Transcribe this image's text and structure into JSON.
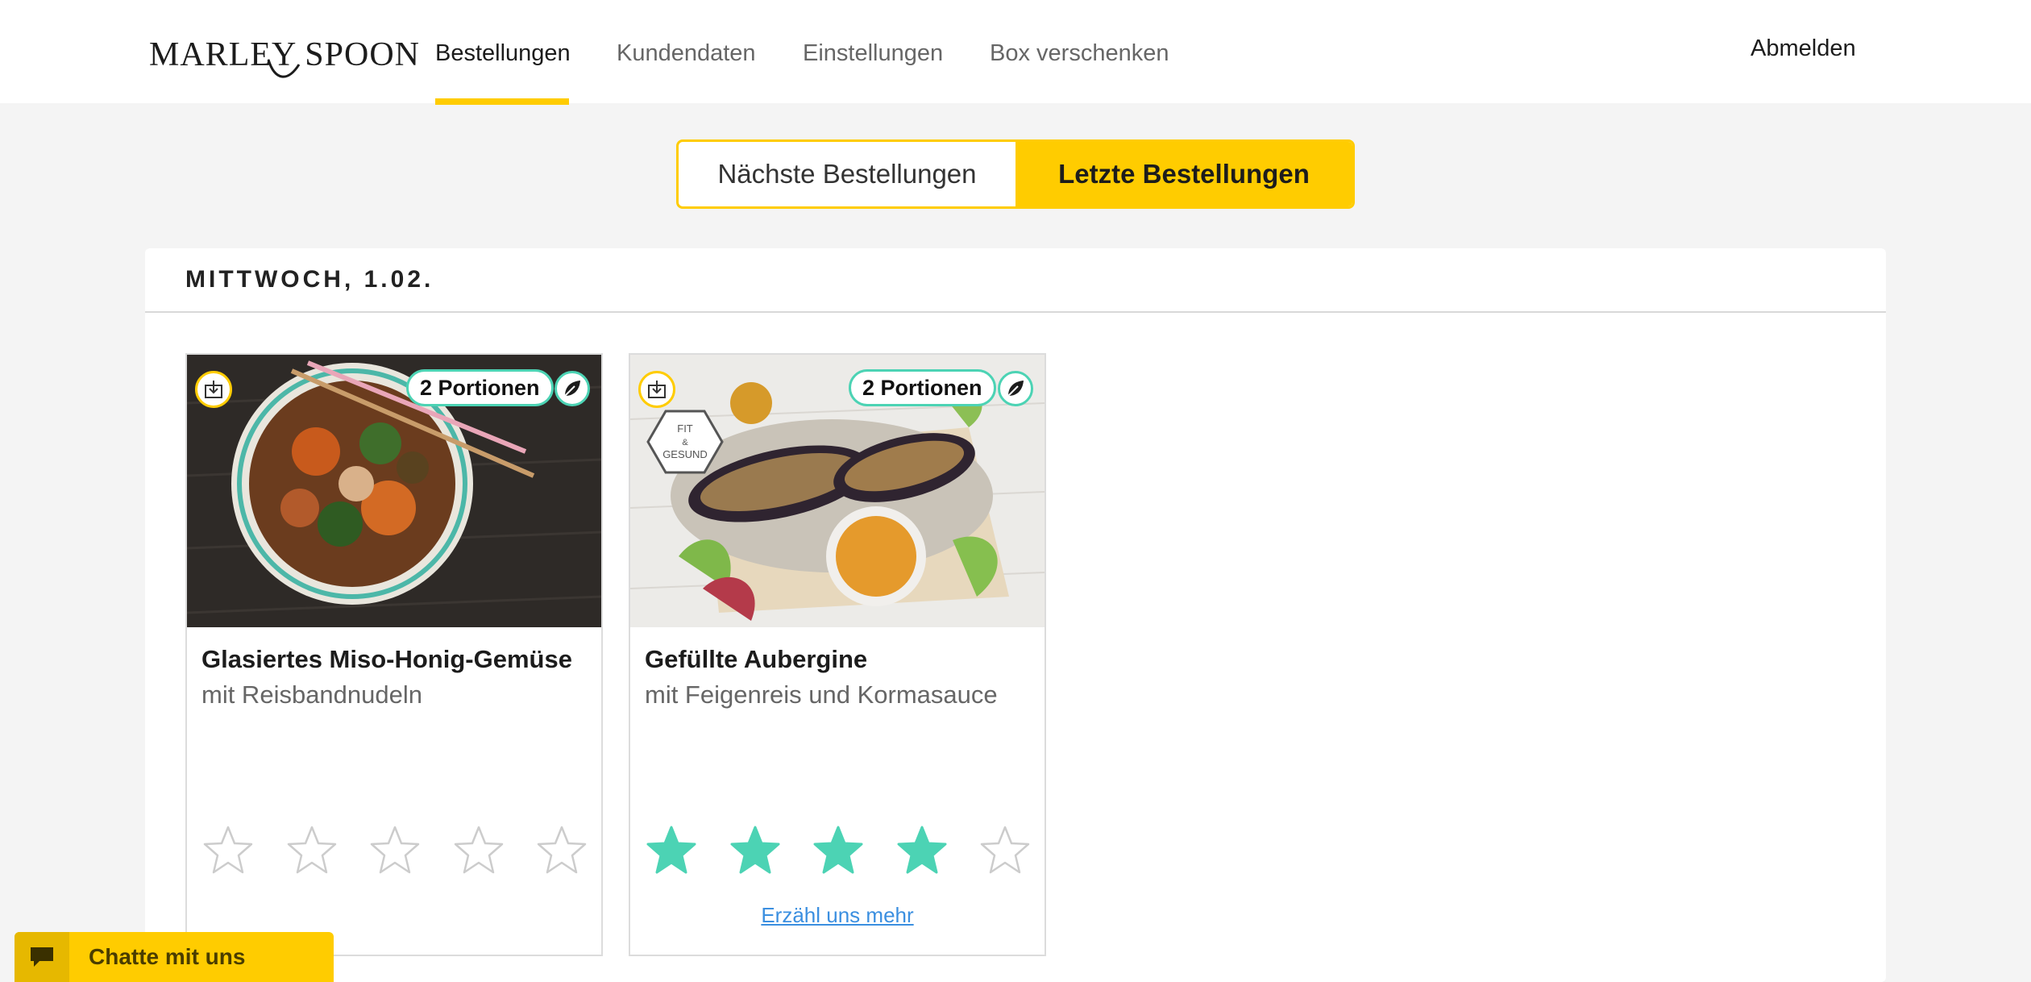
{
  "brand": {
    "logo_text": "MARLEY SPOON"
  },
  "nav": {
    "items": [
      {
        "label": "Bestellungen",
        "active": true
      },
      {
        "label": "Kundendaten",
        "active": false
      },
      {
        "label": "Einstellungen",
        "active": false
      },
      {
        "label": "Box verschenken",
        "active": false
      }
    ],
    "logout_label": "Abmelden"
  },
  "toggle": {
    "upcoming_label": "Nächste Bestellungen",
    "past_label": "Letzte Bestellungen",
    "selected": "past"
  },
  "order_group": {
    "date_label": "MITTWOCH, 1.02.",
    "recipes": [
      {
        "title": "Glasiertes Miso-Honig-Gemüse",
        "subtitle": "mit Reisbandnudeln",
        "portions_label": "2 Portionen",
        "vegetarian_icon": "leaf-icon",
        "rating": 0,
        "max_rating": 5,
        "badge_text": ""
      },
      {
        "title": "Gefüllte Aubergine",
        "subtitle": "mit Feigenreis und Kormasauce",
        "portions_label": "2 Portionen",
        "vegetarian_icon": "leaf-icon",
        "rating": 4,
        "max_rating": 5,
        "badge_text": "FIT & GESUND",
        "feedback_link": "Erzähl uns mehr"
      }
    ]
  },
  "chat": {
    "label": "Chatte mit uns",
    "icon": "chat-bubble-icon"
  },
  "colors": {
    "accent": "#ffcc00",
    "star_filled": "#4cd3b4",
    "star_empty": "#cccccc",
    "link": "#3b8fe0"
  }
}
